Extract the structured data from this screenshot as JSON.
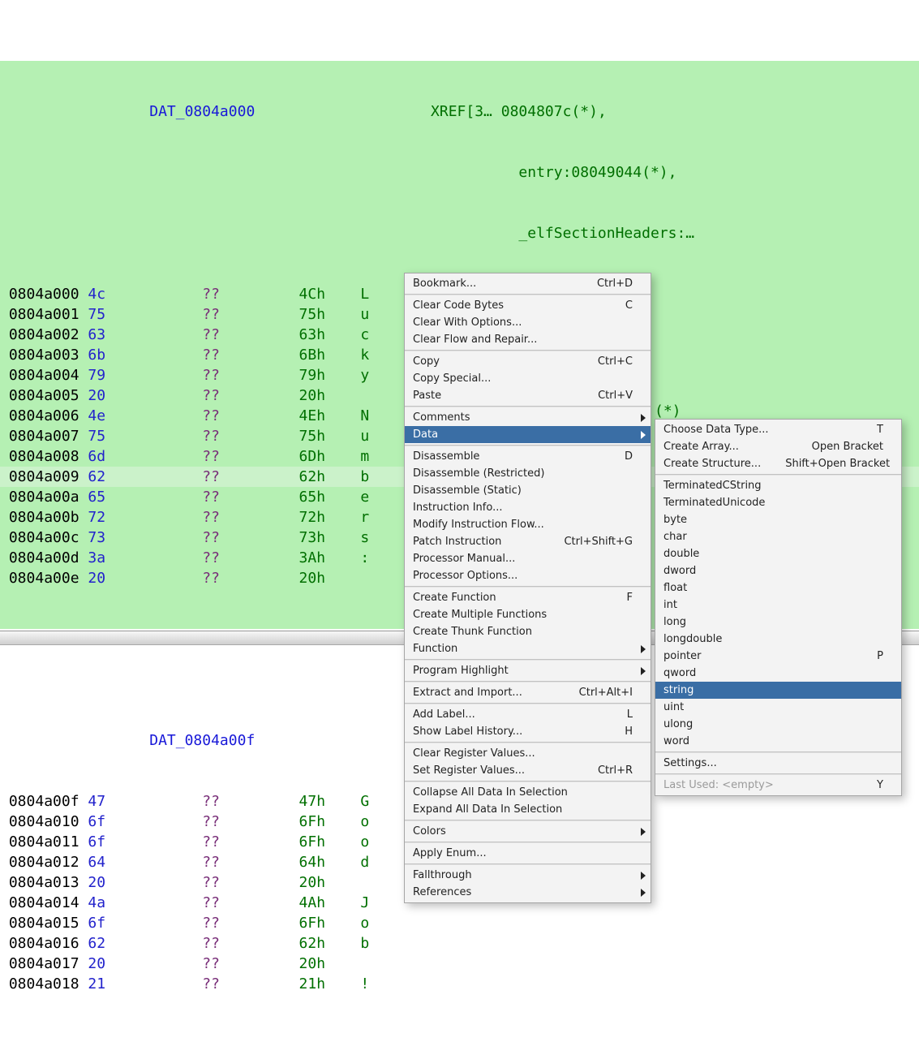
{
  "colors": {
    "selection_bg": "#b5f0b3",
    "cursor_bg": "#cbf2ca",
    "label": "#1818d8",
    "hex": "#2222cc",
    "qq": "#772c77",
    "val": "#006f00",
    "menu_highlight": "#3A6EA5"
  },
  "labels": {
    "label1": "DAT_0804a000",
    "label2": "DAT_0804a00f"
  },
  "xref": {
    "header": "XREF[3…",
    "lines": [
      {
        "text": "0804807c(*),"
      },
      {
        "text": "entry:08049044(*),"
      },
      {
        "text": "_elfSectionHeaders:…"
      }
    ]
  },
  "rows_selected": [
    {
      "addr": "0804a000",
      "hex": "4c",
      "qq": "??",
      "val": "4Ch",
      "chr": "L"
    },
    {
      "addr": "0804a001",
      "hex": "75",
      "qq": "??",
      "val": "75h",
      "chr": "u"
    },
    {
      "addr": "0804a002",
      "hex": "63",
      "qq": "??",
      "val": "63h",
      "chr": "c"
    },
    {
      "addr": "0804a003",
      "hex": "6b",
      "qq": "??",
      "val": "6Bh",
      "chr": "k"
    },
    {
      "addr": "0804a004",
      "hex": "79",
      "qq": "??",
      "val": "79h",
      "chr": "y"
    },
    {
      "addr": "0804a005",
      "hex": "20",
      "qq": "??",
      "val": "20h",
      "chr": " "
    },
    {
      "addr": "0804a006",
      "hex": "4e",
      "qq": "??",
      "val": "4Eh",
      "chr": "N"
    },
    {
      "addr": "0804a007",
      "hex": "75",
      "qq": "??",
      "val": "75h",
      "chr": "u"
    },
    {
      "addr": "0804a008",
      "hex": "6d",
      "qq": "??",
      "val": "6Dh",
      "chr": "m"
    },
    {
      "addr": "0804a009",
      "hex": "62",
      "qq": "??",
      "val": "62h",
      "chr": "b",
      "cursor": true
    },
    {
      "addr": "0804a00a",
      "hex": "65",
      "qq": "??",
      "val": "65h",
      "chr": "e"
    },
    {
      "addr": "0804a00b",
      "hex": "72",
      "qq": "??",
      "val": "72h",
      "chr": "r"
    },
    {
      "addr": "0804a00c",
      "hex": "73",
      "qq": "??",
      "val": "73h",
      "chr": "s"
    },
    {
      "addr": "0804a00d",
      "hex": "3a",
      "qq": "??",
      "val": "3Ah",
      "chr": ":"
    },
    {
      "addr": "0804a00e",
      "hex": "20",
      "qq": "??",
      "val": "20h",
      "chr": " "
    }
  ],
  "rows_white": [
    {
      "addr": "0804a00f",
      "hex": "47",
      "qq": "??",
      "val": "47h",
      "chr": "G"
    },
    {
      "addr": "0804a010",
      "hex": "6f",
      "qq": "??",
      "val": "6Fh",
      "chr": "o"
    },
    {
      "addr": "0804a011",
      "hex": "6f",
      "qq": "??",
      "val": "6Fh",
      "chr": "o"
    },
    {
      "addr": "0804a012",
      "hex": "64",
      "qq": "??",
      "val": "64h",
      "chr": "d"
    },
    {
      "addr": "0804a013",
      "hex": "20",
      "qq": "??",
      "val": "20h",
      "chr": " "
    },
    {
      "addr": "0804a014",
      "hex": "4a",
      "qq": "??",
      "val": "4Ah",
      "chr": "J"
    },
    {
      "addr": "0804a015",
      "hex": "6f",
      "qq": "??",
      "val": "6Fh",
      "chr": "o"
    },
    {
      "addr": "0804a016",
      "hex": "62",
      "qq": "??",
      "val": "62h",
      "chr": "b"
    },
    {
      "addr": "0804a017",
      "hex": "20",
      "qq": "??",
      "val": "20h",
      "chr": " "
    },
    {
      "addr": "0804a018",
      "hex": "21",
      "qq": "??",
      "val": "21h",
      "chr": "!"
    }
  ],
  "xref2_tail": "(*)",
  "menu1": [
    {
      "label": "Bookmark...",
      "shortcut": "Ctrl+D"
    },
    {
      "sep": true
    },
    {
      "label": "Clear Code Bytes",
      "shortcut": "C"
    },
    {
      "label": "Clear With Options..."
    },
    {
      "label": "Clear Flow and Repair..."
    },
    {
      "sep": true
    },
    {
      "label": "Copy",
      "shortcut": "Ctrl+C"
    },
    {
      "label": "Copy Special..."
    },
    {
      "label": "Paste",
      "shortcut": "Ctrl+V"
    },
    {
      "sep": true
    },
    {
      "label": "Comments",
      "submenu": true
    },
    {
      "label": "Data",
      "submenu": true,
      "highlight": true
    },
    {
      "sep": true
    },
    {
      "label": "Disassemble",
      "shortcut": "D"
    },
    {
      "label": "Disassemble (Restricted)"
    },
    {
      "label": "Disassemble (Static)"
    },
    {
      "label": "Instruction Info..."
    },
    {
      "label": "Modify Instruction Flow..."
    },
    {
      "label": "Patch Instruction",
      "shortcut": "Ctrl+Shift+G"
    },
    {
      "label": "Processor Manual..."
    },
    {
      "label": "Processor Options..."
    },
    {
      "sep": true
    },
    {
      "label": "Create Function",
      "shortcut": "F"
    },
    {
      "label": "Create Multiple Functions"
    },
    {
      "label": "Create Thunk Function"
    },
    {
      "label": "Function",
      "submenu": true
    },
    {
      "sep": true
    },
    {
      "label": "Program Highlight",
      "submenu": true
    },
    {
      "sep": true
    },
    {
      "label": "Extract and Import...",
      "shortcut": "Ctrl+Alt+I"
    },
    {
      "sep": true
    },
    {
      "label": "Add Label...",
      "shortcut": "L"
    },
    {
      "label": "Show Label History...",
      "shortcut": "H"
    },
    {
      "sep": true
    },
    {
      "label": "Clear Register Values..."
    },
    {
      "label": "Set Register Values...",
      "shortcut": "Ctrl+R"
    },
    {
      "sep": true
    },
    {
      "label": "Collapse All Data In Selection"
    },
    {
      "label": "Expand All Data In Selection"
    },
    {
      "sep": true
    },
    {
      "label": "Colors",
      "submenu": true
    },
    {
      "sep": true
    },
    {
      "label": "Apply Enum..."
    },
    {
      "sep": true
    },
    {
      "label": "Fallthrough",
      "submenu": true
    },
    {
      "label": "References",
      "submenu": true
    }
  ],
  "menu2": [
    {
      "label": "Choose Data Type...",
      "shortcut": "T"
    },
    {
      "label": "Create Array...",
      "shortcut": "Open Bracket"
    },
    {
      "label": "Create Structure...",
      "shortcut": "Shift+Open Bracket"
    },
    {
      "sep": true
    },
    {
      "label": "TerminatedCString"
    },
    {
      "label": "TerminatedUnicode"
    },
    {
      "label": "byte"
    },
    {
      "label": "char"
    },
    {
      "label": "double"
    },
    {
      "label": "dword"
    },
    {
      "label": "float"
    },
    {
      "label": "int"
    },
    {
      "label": "long"
    },
    {
      "label": "longdouble"
    },
    {
      "label": "pointer",
      "shortcut": "P"
    },
    {
      "label": "qword"
    },
    {
      "label": "string",
      "highlight": true
    },
    {
      "label": "uint"
    },
    {
      "label": "ulong"
    },
    {
      "label": "word"
    },
    {
      "sep": true
    },
    {
      "label": "Settings..."
    },
    {
      "sep": true
    },
    {
      "label": "Last Used: <empty>",
      "shortcut": "Y",
      "disabled": true
    }
  ]
}
